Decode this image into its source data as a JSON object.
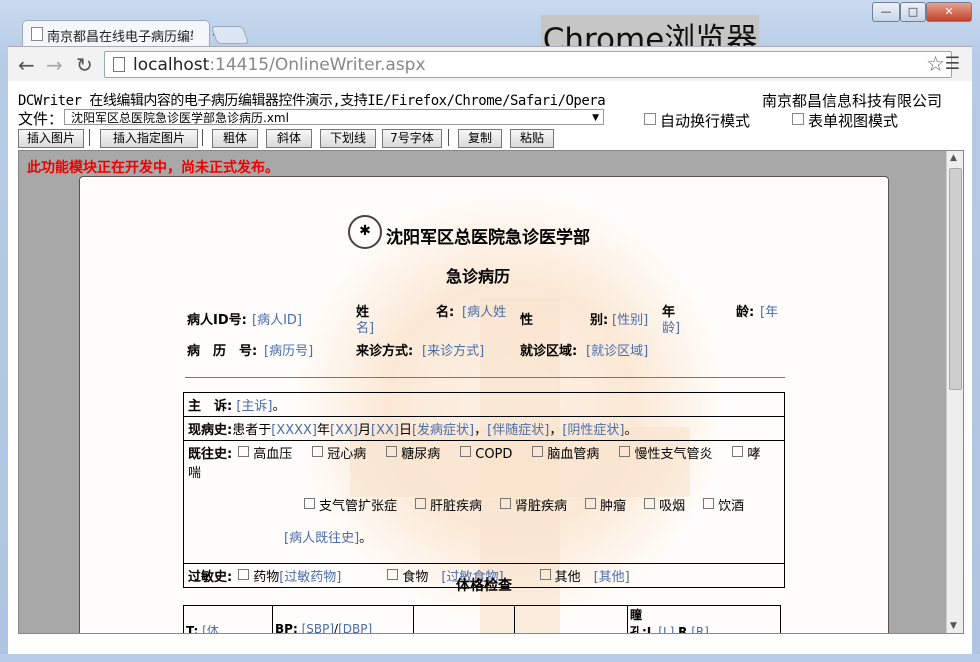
{
  "browser": {
    "tab_title": "南京都昌在线电子病历编辑",
    "tab_close": "×",
    "overlay_label": "Chrome浏览器",
    "url_host": "localhost",
    "url_rest": ":14415/OnlineWriter.aspx",
    "window_min": "—",
    "window_max": "□",
    "window_close": "✕"
  },
  "header": {
    "line1": "DCWriter 在线编辑内容的电子病历编辑器控件演示,支持IE/Firefox/Chrome/Safari/Opera",
    "company": "南京都昌信息科技有限公司",
    "file_label": "文件：",
    "file_selected": "沈阳军区总医院急诊医学部急诊病历.xml",
    "auto_wrap": "自动换行模式",
    "form_view": "表单视图模式"
  },
  "toolbar": {
    "insert_image": "插入图片",
    "insert_specific_image": "插入指定图片",
    "bold": "粗体",
    "italic": "斜体",
    "underline": "下划线",
    "font7": "7号字体",
    "copy": "复制",
    "paste": "粘贴"
  },
  "notice": "此功能模块正在开发中，尚未正式发布。",
  "doc": {
    "hospital": "沈阳军区总医院急诊医学部",
    "title": "急诊病历",
    "patient_id_label": "病人ID号:",
    "patient_id_value": "[病人ID]",
    "name_label_a": "姓",
    "name_label_b": "名:",
    "name_value_a": "[病人姓",
    "name_value_b": "名]",
    "sex_label_a": "性",
    "sex_label_b": "别:",
    "sex_value": "[性别]",
    "age_label_a": "年",
    "age_label_b": "龄:",
    "age_value_a": "[年",
    "age_value_b": "龄]",
    "record_label": "病　历　号:",
    "record_value": "[病历号]",
    "visit_label": "来诊方式:",
    "visit_value": "[来诊方式]",
    "area_label": "就诊区域:",
    "area_value": "[就诊区域]",
    "complaint_label": "主　诉:",
    "complaint_value": "[主诉]",
    "complaint_end": "。",
    "present_label": "现病史:",
    "present_text_1": "患者于",
    "present_v1": "[XXXX]",
    "present_t2": "年",
    "present_v2": "[XX]",
    "present_t3": "月",
    "present_v3": "[XX]",
    "present_t4": "日",
    "present_v4": "[发病症状]",
    "present_v5": "[伴随症状]",
    "present_v6": "[阴性症状]",
    "past_label": "既往史:",
    "past_items_row1": [
      "高血压",
      "冠心病",
      "糖尿病",
      "COPD",
      "脑血管病",
      "慢性支气管炎",
      "哮"
    ],
    "past_item_wrap": "喘",
    "past_items_row2": [
      "支气管扩张症",
      "肝脏疾病",
      "肾脏疾病",
      "肿瘤",
      "吸烟",
      "饮酒"
    ],
    "past_value": "[病人既往史]",
    "allergy_label": "过敏史:",
    "allergy_drug": "药物",
    "allergy_drug_value": "[过敏药物]",
    "allergy_food": "食物",
    "allergy_food_value": "[过敏食物]",
    "allergy_other": "其他",
    "allergy_other_value": "[其他]",
    "exam_title": "体格检查",
    "exam_t": "T:",
    "exam_t_value": "[体",
    "exam_bp": "BP:",
    "exam_sbp": "[SBP]",
    "exam_slash": "/",
    "exam_dbp": "[DBP]",
    "exam_pupil_a": "瞳",
    "exam_pupil_b": "孔:L",
    "exam_l": "[L]",
    "exam_r": "R",
    "exam_r_val": "[R]"
  }
}
